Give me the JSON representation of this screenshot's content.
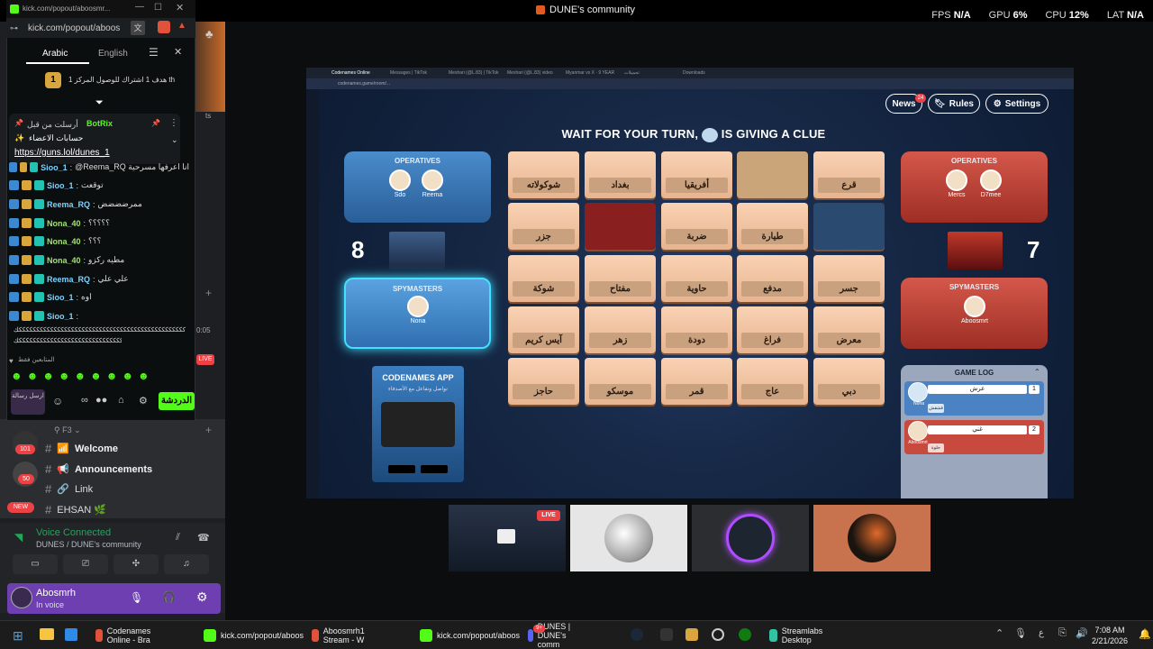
{
  "overlay": {
    "window_title": "DUNE's community",
    "fps_label": "FPS",
    "fps_value": "N/A",
    "gpu_label": "GPU",
    "gpu_value": "6%",
    "cpu_label": "CPU",
    "cpu_value": "12%",
    "lat_label": "LAT",
    "lat_value": "N/A"
  },
  "kick": {
    "window_title": "kick.com/popout/aboosmr...",
    "url": "kick.com/popout/aboos",
    "tab_arabic": "Arabic",
    "tab_english": "English",
    "goal_text": "هدف 1 اشتراك للوصول المركز 1 th",
    "goal_number": "1",
    "pinned_by": "أرسلت من قبل",
    "pinned_user": "BotRix",
    "pinned_title": "حسابات الاعضاء",
    "pinned_link": "https://guns.lol/dunes_1",
    "chat": [
      {
        "user": "Sioo_1",
        "msg": "@Reema_RQ انا اعرفها مسرحية"
      },
      {
        "user": "Sioo_1",
        "msg": "توقعت"
      },
      {
        "user": "Reema_RQ",
        "msg": "ممرضضضض"
      },
      {
        "user": "Nona_40",
        "msg": "؟؟؟؟؟"
      },
      {
        "user": "Nona_40",
        "msg": "؟؟؟"
      },
      {
        "user": "Nona_40",
        "msg": "مطيه ركزو"
      },
      {
        "user": "Reema_RQ",
        "msg": "علي علي"
      },
      {
        "user": "Sioo_1",
        "msg": "اوه"
      },
      {
        "user": "Sioo_1",
        "msg": ""
      }
    ],
    "long_message": "ككككككككككككككككككككككككككككككككككككككككككككككككك",
    "viewers_label": "المتابعين فقط",
    "send_placeholder": "ارسل رسالة",
    "chat_button": "الدردشة"
  },
  "discord": {
    "category": "F3",
    "channels": [
      {
        "name": "Welcome"
      },
      {
        "name": "Announcements"
      },
      {
        "name": "Link"
      },
      {
        "name": "EHSAN 🌿"
      }
    ],
    "badges": [
      "101",
      "50",
      "NEW"
    ],
    "live_badge": "LIVE",
    "time_chip": "0:05",
    "voice_status": "Voice Connected",
    "voice_channel": "DUNES / DUNE's community",
    "user_name": "Abosmrh",
    "user_status": "In voice",
    "nav_label": "ts"
  },
  "browser": {
    "tabs": [
      "Codenames Online",
      "Messages | TikTok",
      "Meshari (@L.83) | TikTok",
      "Meshari (@L.83) video",
      "Myanmar vs X · 9 YEAR",
      "تحميلات",
      "Downloads"
    ],
    "url": "codenames.game/room/..."
  },
  "game": {
    "news_label": "News",
    "news_badge": "24",
    "rules_label": "Rules",
    "settings_label": "Settings",
    "banner": "WAIT FOR YOUR TURN,",
    "banner_suffix": "IS GIVING A CLUE",
    "blue_team": {
      "operatives_label": "OPERATIVES",
      "operatives": [
        "Sdo",
        "Reema"
      ],
      "spymasters_label": "SPYMASTERS",
      "spymaster": "Nona",
      "score": "8"
    },
    "red_team": {
      "operatives_label": "OPERATIVES",
      "operatives": [
        "Mercs",
        "D7mee"
      ],
      "spymasters_label": "SPYMASTERS",
      "spymaster": "Aboosmrt",
      "score": "7"
    },
    "cards": [
      [
        "شوكولاته",
        "بغداد",
        "أفريقيا",
        "",
        "قرع"
      ],
      [
        "جزر",
        "",
        "ضربة",
        "طيارة",
        ""
      ],
      [
        "شوكة",
        "مفتاح",
        "حاوية",
        "مدفع",
        "جسر"
      ],
      [
        "آيس كريم",
        "زهر",
        "دودة",
        "فراغ",
        "معرض"
      ],
      [
        "حاجز",
        "موسكو",
        "قمر",
        "عاج",
        "دبي"
      ]
    ],
    "app_card_title": "CODENAMES APP",
    "app_card_sub": "تواصل وتفاعل مع الأصدقاء",
    "log_title": "GAME LOG",
    "log": [
      {
        "clue": "عرش",
        "num": "1",
        "player": "Nona",
        "guess": "قشقش"
      },
      {
        "clue": "غني",
        "num": "2",
        "player": "Aboosmrt",
        "guess": "حلوة"
      }
    ]
  },
  "stream": {
    "live_badge": "LIVE"
  },
  "taskbar": {
    "items": [
      {
        "label": "Codenames Online - Bra",
        "color": "#e0533a"
      },
      {
        "label": "kick.com/popout/aboos",
        "color": "#53fc18"
      },
      {
        "label": "Aboosmrh1 Stream - W",
        "color": "#e0533a"
      },
      {
        "label": "kick.com/popout/aboos",
        "color": "#53fc18"
      },
      {
        "label": "DUNES | DUNE's comm",
        "color": "#5865f2"
      },
      {
        "label": "Streamlabs Desktop",
        "color": "#31c3a2"
      }
    ],
    "discord_badge": "9+",
    "time": "7:08 AM",
    "date": "2/21/2026"
  }
}
